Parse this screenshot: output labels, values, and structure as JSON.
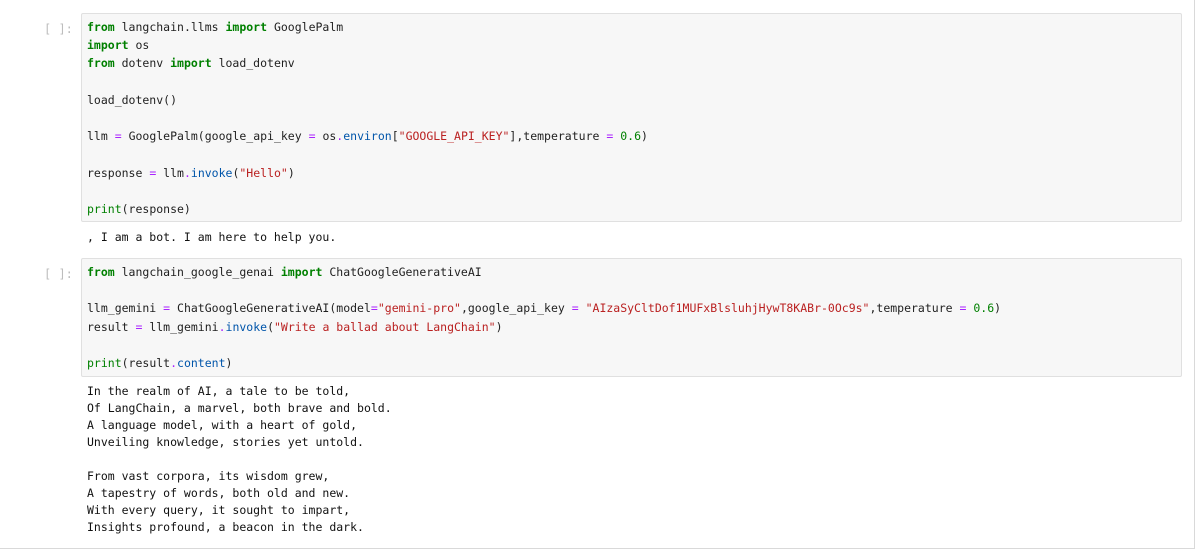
{
  "prompt_label": "[ ]:",
  "cell1": {
    "prompt": "[ ]:",
    "code": [
      [
        {
          "t": "kw",
          "v": "from"
        },
        {
          "t": "",
          "v": " langchain.llms "
        },
        {
          "t": "kw",
          "v": "import"
        },
        {
          "t": "",
          "v": " GooglePalm"
        }
      ],
      [
        {
          "t": "kw",
          "v": "import"
        },
        {
          "t": "",
          "v": " os"
        }
      ],
      [
        {
          "t": "kw",
          "v": "from"
        },
        {
          "t": "",
          "v": " dotenv "
        },
        {
          "t": "kw",
          "v": "import"
        },
        {
          "t": "",
          "v": " load_dotenv"
        }
      ],
      [],
      [
        {
          "t": "",
          "v": "load_dotenv()"
        }
      ],
      [],
      [
        {
          "t": "",
          "v": "llm "
        },
        {
          "t": "op",
          "v": "="
        },
        {
          "t": "",
          "v": " GooglePalm(google_api_key "
        },
        {
          "t": "op",
          "v": "="
        },
        {
          "t": "",
          "v": " os"
        },
        {
          "t": "op",
          "v": "."
        },
        {
          "t": "attr",
          "v": "environ"
        },
        {
          "t": "",
          "v": "["
        },
        {
          "t": "str",
          "v": "\"GOOGLE_API_KEY\""
        },
        {
          "t": "",
          "v": "],temperature "
        },
        {
          "t": "op",
          "v": "="
        },
        {
          "t": "num",
          "v": " 0.6"
        },
        {
          "t": "",
          "v": ")"
        }
      ],
      [],
      [
        {
          "t": "",
          "v": "response "
        },
        {
          "t": "op",
          "v": "="
        },
        {
          "t": "",
          "v": " llm"
        },
        {
          "t": "op",
          "v": "."
        },
        {
          "t": "attr",
          "v": "invoke"
        },
        {
          "t": "",
          "v": "("
        },
        {
          "t": "str",
          "v": "\"Hello\""
        },
        {
          "t": "",
          "v": ")"
        }
      ],
      [],
      [
        {
          "t": "fn",
          "v": "print"
        },
        {
          "t": "",
          "v": "(response)"
        }
      ]
    ],
    "output": [
      ", I am a bot. I am here to help you."
    ]
  },
  "cell2": {
    "prompt": "[ ]:",
    "code": [
      [
        {
          "t": "kw",
          "v": "from"
        },
        {
          "t": "",
          "v": " langchain_google_genai "
        },
        {
          "t": "kw",
          "v": "import"
        },
        {
          "t": "",
          "v": " ChatGoogleGenerativeAI"
        }
      ],
      [],
      [
        {
          "t": "",
          "v": "llm_gemini "
        },
        {
          "t": "op",
          "v": "="
        },
        {
          "t": "",
          "v": " ChatGoogleGenerativeAI(model"
        },
        {
          "t": "op",
          "v": "="
        },
        {
          "t": "str",
          "v": "\"gemini-pro\""
        },
        {
          "t": "",
          "v": ",google_api_key "
        },
        {
          "t": "op",
          "v": "="
        },
        {
          "t": "",
          "v": " "
        },
        {
          "t": "str",
          "v": "\"AIzaSyCltDof1MUFxBlsluhjHywT8KABr-0Oc9s\""
        },
        {
          "t": "",
          "v": ",temperature "
        },
        {
          "t": "op",
          "v": "="
        },
        {
          "t": "num",
          "v": " 0.6"
        },
        {
          "t": "",
          "v": ")"
        }
      ],
      [
        {
          "t": "",
          "v": "result "
        },
        {
          "t": "op",
          "v": "="
        },
        {
          "t": "",
          "v": " llm_gemini"
        },
        {
          "t": "op",
          "v": "."
        },
        {
          "t": "attr",
          "v": "invoke"
        },
        {
          "t": "",
          "v": "("
        },
        {
          "t": "str",
          "v": "\"Write a ballad about LangChain\""
        },
        {
          "t": "",
          "v": ")"
        }
      ],
      [],
      [
        {
          "t": "fn",
          "v": "print"
        },
        {
          "t": "",
          "v": "(result"
        },
        {
          "t": "op",
          "v": "."
        },
        {
          "t": "attr",
          "v": "content"
        },
        {
          "t": "",
          "v": ")"
        }
      ]
    ],
    "output": [
      "In the realm of AI, a tale to be told,",
      "Of LangChain, a marvel, both brave and bold.",
      "A language model, with a heart of gold,",
      "Unveiling knowledge, stories yet untold.",
      "",
      "From vast corpora, its wisdom grew,",
      "A tapestry of words, both old and new.",
      "With every query, it sought to impart,",
      "Insights profound, a beacon in the dark."
    ]
  }
}
